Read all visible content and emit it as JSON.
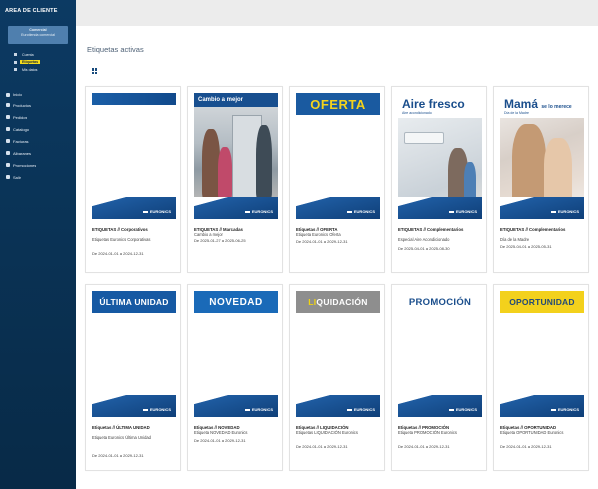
{
  "sidebar": {
    "brand": "ÁREA DE CLIENTE",
    "user": {
      "line1": "Comercial",
      "line2": "Eurotienda comercial"
    },
    "sub_links": [
      {
        "label": "Cuenta"
      },
      {
        "label": "Etiquetas"
      },
      {
        "label": "Mis datos"
      }
    ],
    "nav": [
      {
        "label": "Inicio",
        "icon": "home-icon"
      },
      {
        "label": "Productos",
        "icon": "box-icon"
      },
      {
        "label": "Pedidos",
        "icon": "cart-icon"
      },
      {
        "label": "Catalogo",
        "icon": "book-icon"
      },
      {
        "label": "Facturas",
        "icon": "doc-icon"
      },
      {
        "label": "Albaranes",
        "icon": "list-icon"
      },
      {
        "label": "Promociones",
        "icon": "tag-icon"
      },
      {
        "label": "Salir",
        "icon": "exit-icon"
      }
    ]
  },
  "main": {
    "title": "Etiquetas activas",
    "cards": [
      {
        "banner": "",
        "title": "ETIQUETAS // Corporativos",
        "desc": "Etiquetas Euronics Corporativas",
        "dates": "De 2024-01-01 a 2024-12-31"
      },
      {
        "banner": "Cambio a mejor",
        "title": "ETIQUETAS // Marcadas",
        "desc": "Cambio a mejor",
        "dates": "De 2025-01-27 a 2025-06-25"
      },
      {
        "banner": "OFERTA",
        "title": "Etiquetas // OFERTA",
        "desc": "Etiqueta Euronics Oferta",
        "dates": "De 2024-01-01 a 2029-12-31"
      },
      {
        "banner": "Aire fresco",
        "banner_sub": "Aire acondicionado",
        "title": "ETIQUETAS // Complementarios",
        "desc": "Especial Aire Acondicionado",
        "dates": "De 2025-04-01 a 2025-08-30"
      },
      {
        "banner": "Mamá",
        "banner_small": "se lo merece",
        "banner_sub": "Día de la Madre",
        "title": "ETIQUETAS // Complementarios",
        "desc": "Día de la Madre",
        "dates": "De 2025-04-01 a 2025-05-31"
      },
      {
        "banner": "ÚLTIMA UNIDAD",
        "title": "Etiquetas // ÚLTIMA UNIDAD",
        "desc": "Etiqueta Euronics Última Unidad",
        "dates": "De 2024-01-01 a 2029-12-31"
      },
      {
        "banner": "NOVEDAD",
        "title": "Etiquetas // NOVEDAD",
        "desc": "Etiqueta NOVEDAD Euronics",
        "dates": "De 2024-01-01 a 2029-12-31"
      },
      {
        "banner": "LIQUIDACIÓN",
        "banner_first": "LI",
        "banner_rest": "QUIDACIÓN",
        "title": "Etiquetas // LIQUIDACIÓN",
        "desc": "Etiquetas LIQUIDACIÓN Euronics",
        "dates": "De 2024-01-01 a 2029-12-31"
      },
      {
        "banner": "PROMOCIÓN",
        "title": "Etiquetas // PROMOCIÓN",
        "desc": "Etiqueta PROMOCIÓN Euronics",
        "dates": "De 2024-01-01 a 2029-12-31"
      },
      {
        "banner": "OPORTUNIDAD",
        "title": "Etiquetas // OPORTUNIDAD",
        "desc": "Etiqueta OPORTUNIDAD Euronics",
        "dates": "De 2024-01-01 a 2029-12-31"
      }
    ],
    "footer_logo": "EURONICS"
  },
  "colors": {
    "sidebar": "#0b365d",
    "accent": "#f3dc1b",
    "brand_blue": "#1a4e8c"
  }
}
